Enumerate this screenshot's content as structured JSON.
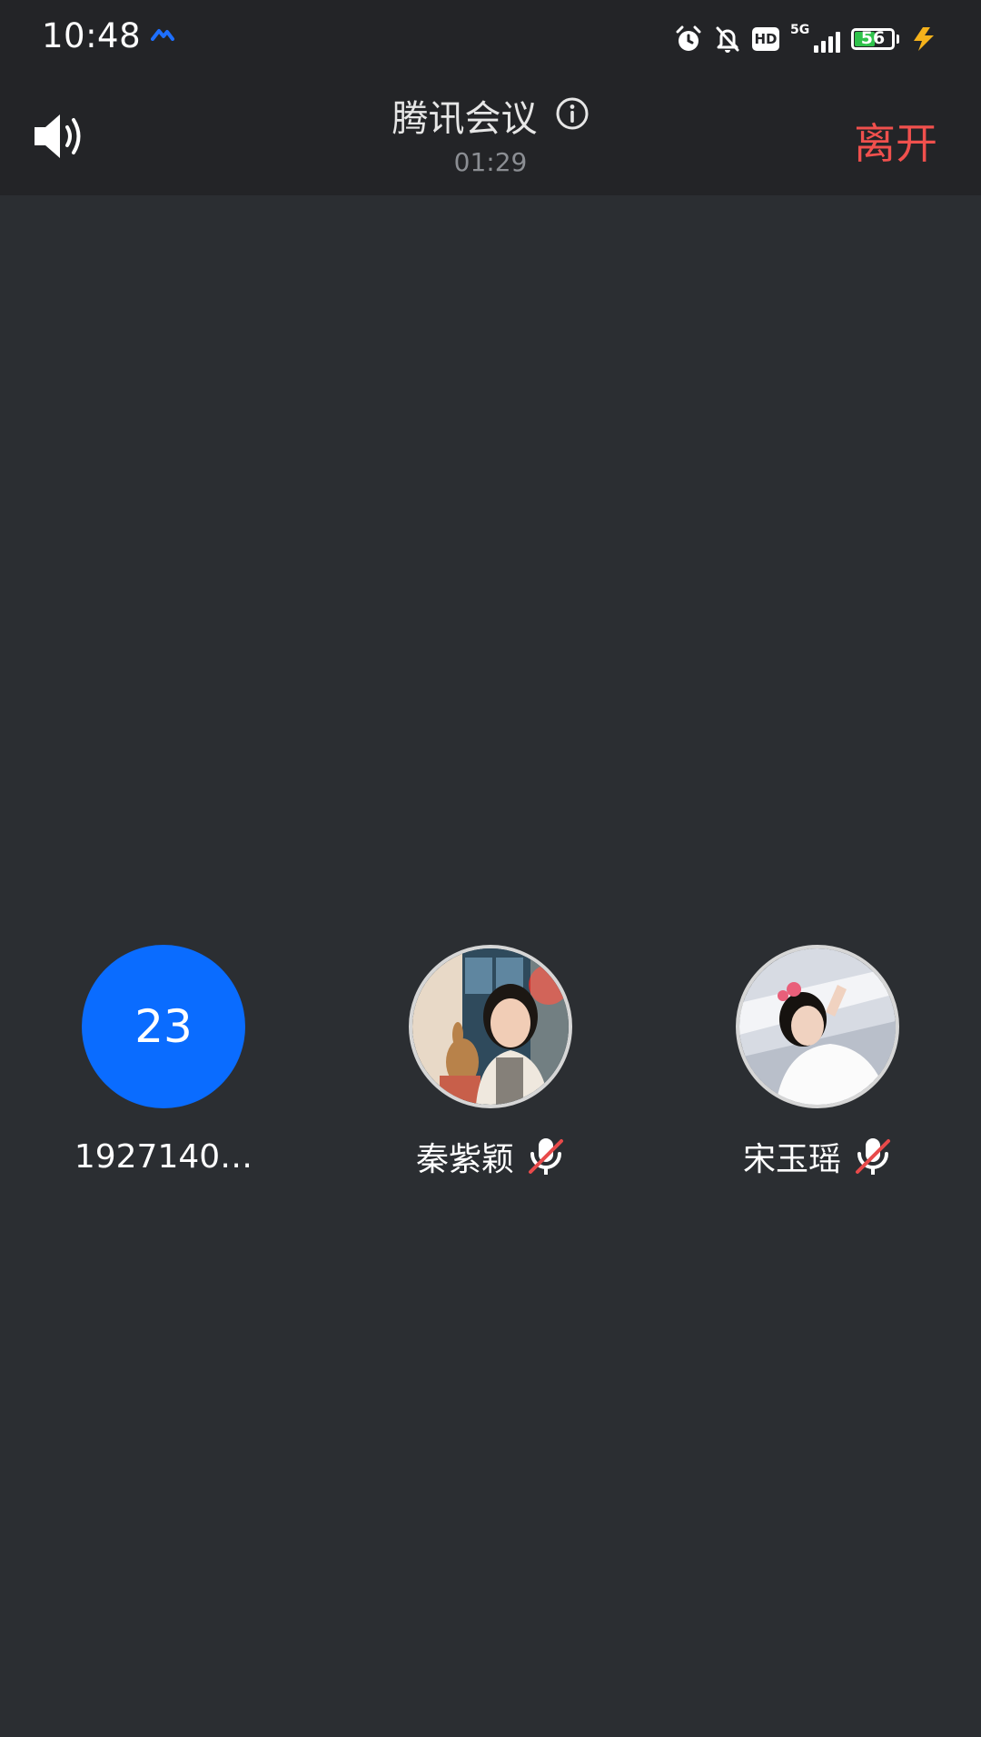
{
  "status_bar": {
    "time": "10:48",
    "network_type": "5G",
    "hd_label": "HD",
    "battery_level": "56",
    "battery_fraction": 0.56,
    "icons": [
      "app-notification-icon",
      "alarm-icon",
      "bell-off-icon",
      "hd-icon",
      "signal-icon",
      "battery-icon",
      "charging-icon"
    ]
  },
  "header": {
    "title": "腾讯会议",
    "duration": "01:29",
    "leave_label": "离开",
    "leave_color": "#f0504d",
    "speaker_icon": "speaker-icon",
    "info_icon": "info-icon"
  },
  "participants": [
    {
      "avatar_text": "23",
      "name": "1927140…",
      "muted": false,
      "avatar_color": "#0a6cff"
    },
    {
      "avatar_text": "",
      "name": "秦紫颖",
      "muted": true
    },
    {
      "avatar_text": "",
      "name": "宋玉瑶",
      "muted": true
    }
  ],
  "colors": {
    "background": "#2b2e32",
    "topbar": "#232427",
    "accent_blue": "#0a6cff",
    "mute_red": "#e84a4a"
  }
}
